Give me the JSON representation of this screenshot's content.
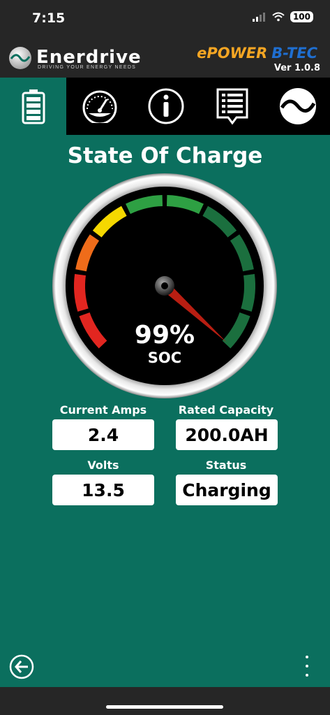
{
  "status_bar": {
    "time": "7:15",
    "battery": "100"
  },
  "header": {
    "brand": "Enerdrive",
    "tagline": "DRIVING YOUR ENERGY NEEDS",
    "product_epower": "ePOWER",
    "product_btec": "B-TEC",
    "version": "Ver 1.0.8"
  },
  "tabs": [
    {
      "icon": "battery-icon",
      "active": true
    },
    {
      "icon": "gauge-icon",
      "active": false
    },
    {
      "icon": "info-icon",
      "active": false
    },
    {
      "icon": "list-icon",
      "active": false
    },
    {
      "icon": "wave-logo-icon",
      "active": false
    }
  ],
  "page": {
    "title": "State Of Charge"
  },
  "gauge": {
    "value_percent": 99,
    "value_text": "99%",
    "label": "SOC"
  },
  "readouts": {
    "current_amps": {
      "label": "Current Amps",
      "value": "2.4"
    },
    "rated_capacity": {
      "label": "Rated Capacity",
      "value": "200.0AH"
    },
    "volts": {
      "label": "Volts",
      "value": "13.5"
    },
    "status": {
      "label": "Status",
      "value": "Charging"
    }
  },
  "colors": {
    "background": "#0b6f5e",
    "header": "#262626",
    "gauge_red": "#e22620",
    "gauge_orange": "#ef6c1a",
    "gauge_yellow": "#f5d800",
    "gauge_green": "#2ea043",
    "gauge_dark_green": "#1b6f3e",
    "needle": "#b81e12"
  }
}
